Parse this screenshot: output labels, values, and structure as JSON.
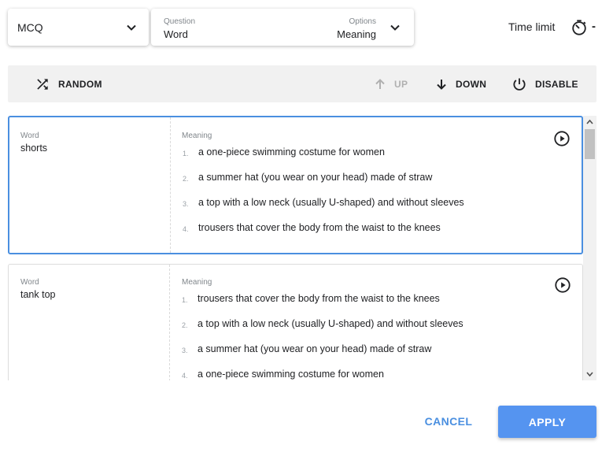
{
  "mode": {
    "value": "MCQ"
  },
  "question_options": {
    "question_label": "Question",
    "question_value": "Word",
    "options_label": "Options",
    "options_value": "Meaning"
  },
  "time_limit": {
    "label": "Time limit",
    "value": "-"
  },
  "toolbar": {
    "random": "RANDOM",
    "up": "UP",
    "down": "DOWN",
    "disable": "DISABLE"
  },
  "cards": [
    {
      "word_label": "Word",
      "word": "shorts",
      "meaning_label": "Meaning",
      "options": [
        {
          "num": "1.",
          "text": "a one-piece swimming costume for women"
        },
        {
          "num": "2.",
          "text": "a summer hat (you wear on your head) made of straw"
        },
        {
          "num": "3.",
          "text": "a top with a low neck (usually U-shaped) and without sleeves"
        },
        {
          "num": "4.",
          "text": "trousers that cover the body from the waist to the knees"
        }
      ]
    },
    {
      "word_label": "Word",
      "word": "tank top",
      "meaning_label": "Meaning",
      "options": [
        {
          "num": "1.",
          "text": "trousers that cover the body from the waist to the knees"
        },
        {
          "num": "2.",
          "text": "a top with a low neck (usually U-shaped) and without sleeves"
        },
        {
          "num": "3.",
          "text": "a summer hat (you wear on your head) made of straw"
        },
        {
          "num": "4.",
          "text": "a one-piece swimming costume for women"
        }
      ]
    }
  ],
  "footer": {
    "cancel": "CANCEL",
    "apply": "APPLY"
  },
  "colors": {
    "accent": "#4a8fe0",
    "apply_bg": "#5594f0",
    "toolbar_bg": "#f1f1f1"
  },
  "icons": [
    "chevron-down-icon",
    "timer-icon",
    "shuffle-icon",
    "arrow-up-icon",
    "arrow-down-icon",
    "power-icon",
    "play-icon"
  ]
}
